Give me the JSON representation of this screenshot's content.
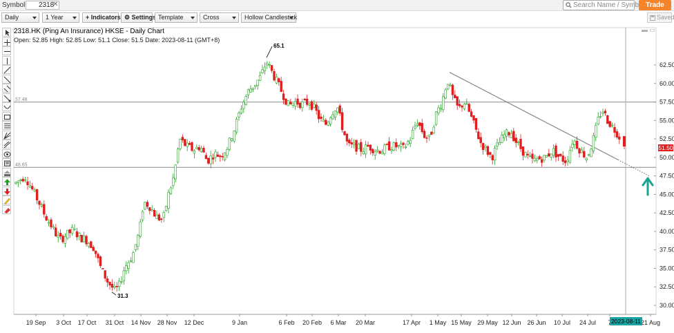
{
  "topbar": {
    "symbols_label": "Symbols:",
    "symbol_value": "2318",
    "search_placeholder": "Search Name / Symbol",
    "trade_label": "Trade"
  },
  "toolbar": {
    "interval": "Daily",
    "range": "1 Year",
    "indicators": "+ Indicators",
    "settings": "⚙ Settings",
    "template": "Template",
    "crosshair": "Cross",
    "chart_style": "Hollow Candlestick",
    "saved": "Saved"
  },
  "header": {
    "title": "2318.HK (Ping An Insurance) HKSE - Daily Chart",
    "ohlc": "Open: 52.85  High: 52.85  Low: 51.1  Close: 51.5  Date: 2023-08-11 (GMT+8)"
  },
  "tools": [
    "cursor-icon",
    "crosshair-icon",
    "horizontal-line-icon",
    "vertical-line-icon",
    "trend-line-icon",
    "ray-icon",
    "channel-icon",
    "arrow-line-icon",
    "arc-icon",
    "rectangle-icon",
    "fibonacci-icon",
    "gann-icon",
    "pitchfork-icon",
    "ellipse-icon",
    "text-icon",
    "layers-icon",
    "up-arrow-icon",
    "down-arrow-icon",
    "pencil-icon",
    "eraser-icon"
  ],
  "price_badge": "51.50",
  "date_badge": "2023-08-11",
  "chart_data": {
    "type": "candlestick",
    "title": "2318.HK (Ping An Insurance) HKSE - Daily Chart",
    "y_ticks": [
      "62.50",
      "60.00",
      "57.50",
      "55.00",
      "52.50",
      "50.00",
      "47.50",
      "45.00",
      "42.50",
      "40.00",
      "37.50",
      "35.00",
      "32.50",
      "30.00"
    ],
    "x_ticks": [
      "19 Sep",
      "3 Oct",
      "17 Oct",
      "31 Oct",
      "14 Nov",
      "28 Nov",
      "12 Dec",
      "9 Jan",
      "6 Feb",
      "20 Feb",
      "6 Mar",
      "20 Mar",
      "17 Apr",
      "1 May",
      "15 May",
      "29 May",
      "12 Jun",
      "26 Jun",
      "10 Jul",
      "24 Jul",
      "7",
      "21 Aug"
    ],
    "ylim": [
      28.5,
      65.8
    ],
    "horizontal_levels": [
      {
        "label": "57.48",
        "value": 57.48
      },
      {
        "label": "48.65",
        "value": 48.65
      }
    ],
    "annotations": [
      {
        "text": "65.1",
        "value": 65.1
      },
      {
        "text": "31.3",
        "value": 31.3
      }
    ],
    "trendline": {
      "from": {
        "date": "2023-05-08",
        "value": 61.5
      },
      "to": {
        "date": "2023-08-24",
        "value": 47.5
      }
    },
    "last": {
      "date": "2023-08-11",
      "open": 52.85,
      "high": 52.85,
      "low": 51.1,
      "close": 51.5
    },
    "colors": {
      "up": "#22a022",
      "down": "#e02020",
      "levels": "#888888",
      "trend": "#888888",
      "crosshair_badge": "#1aa3a3",
      "arrow": "#1aa38f"
    }
  }
}
